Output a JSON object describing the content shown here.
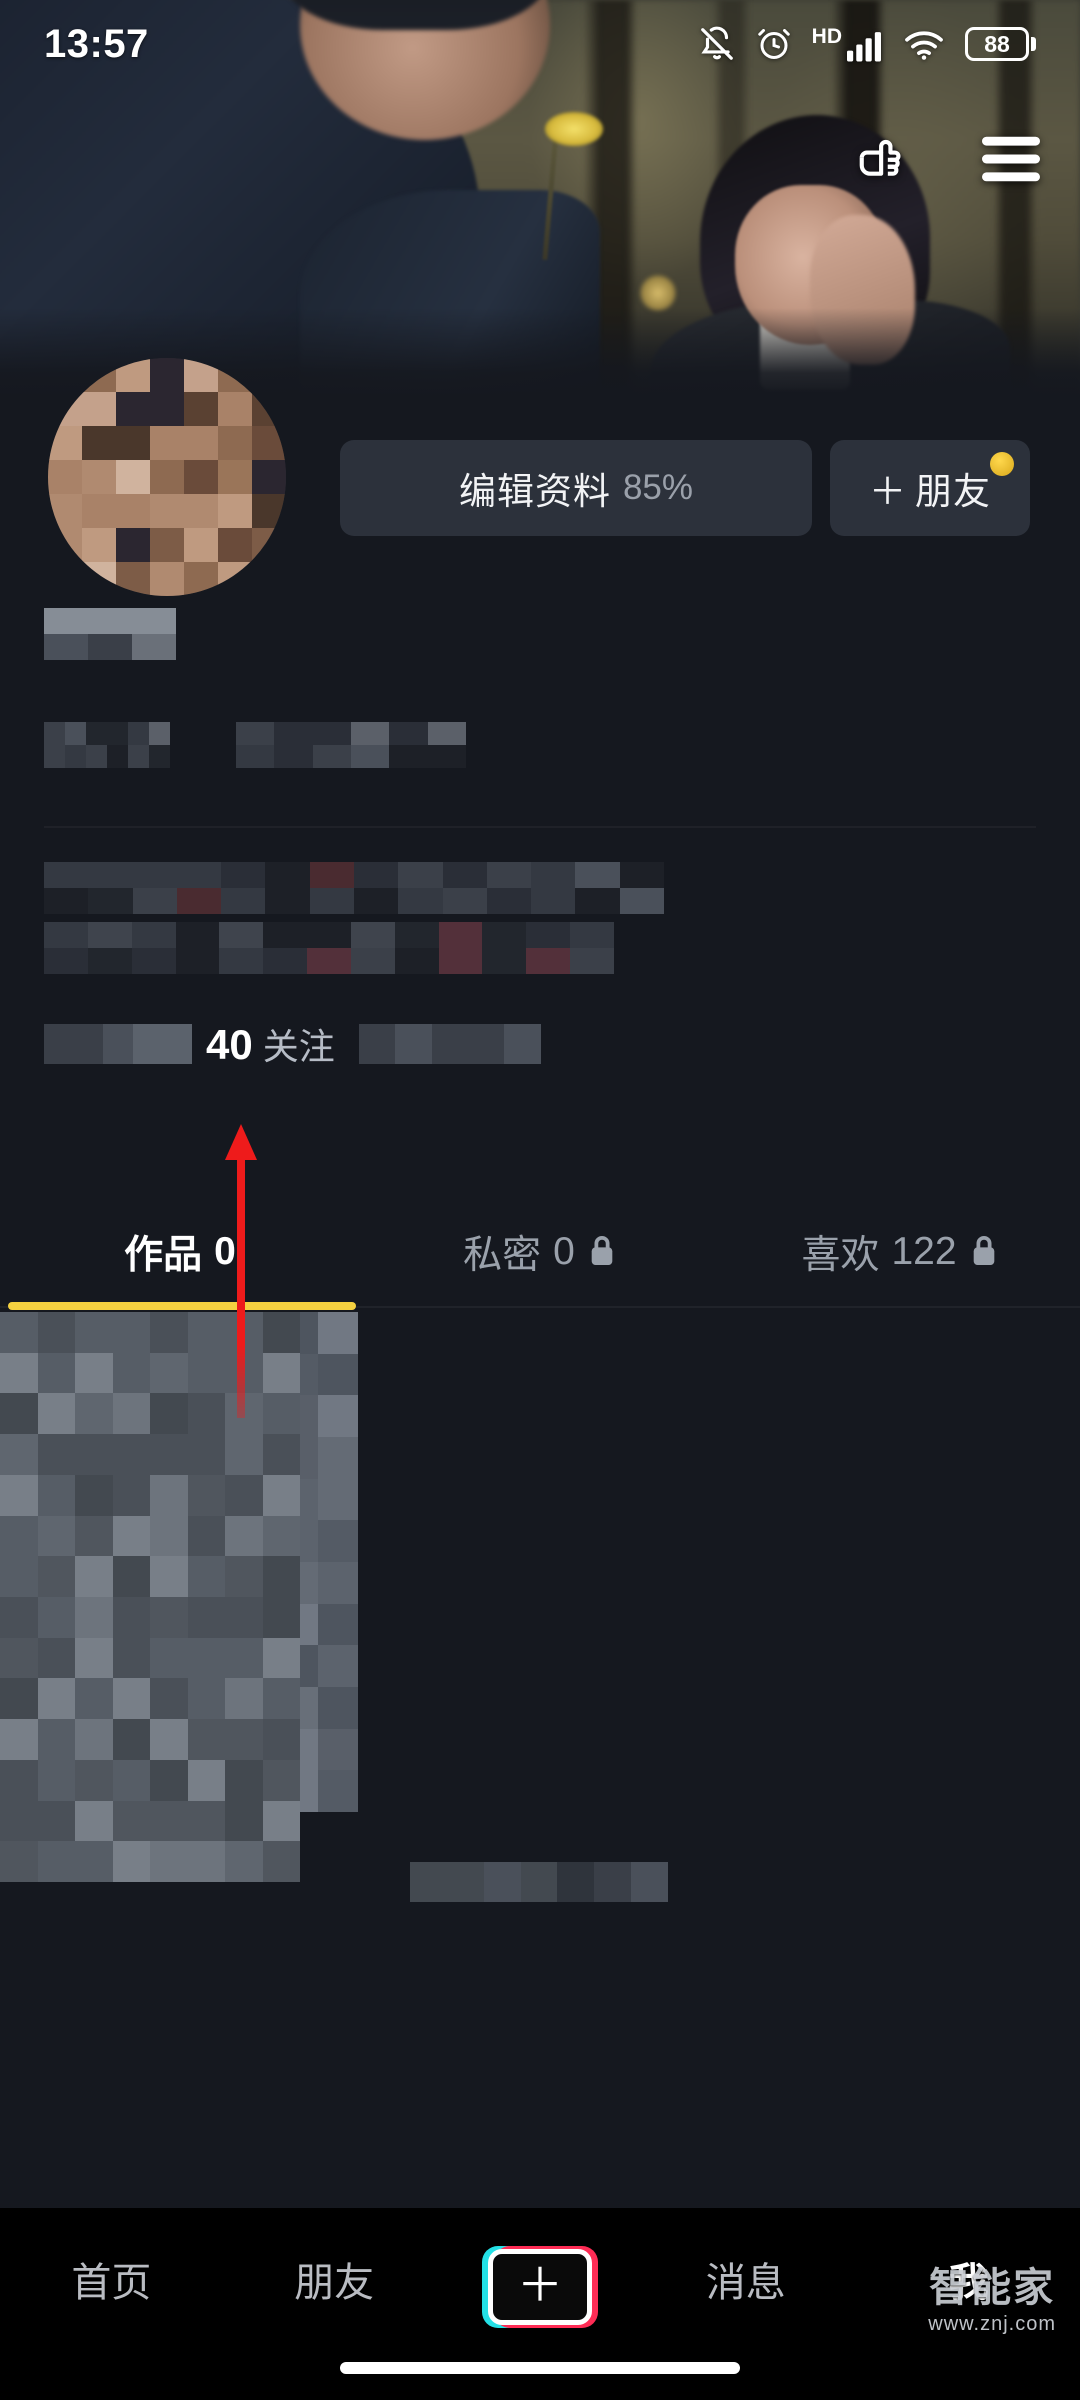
{
  "status_bar": {
    "time": "13:57",
    "battery_level": "88",
    "icons": [
      "bell-mute-icon",
      "alarm-clock-icon",
      "hd-icon",
      "signal-bars-icon",
      "wifi-icon",
      "battery-icon"
    ],
    "hd_label": "HD"
  },
  "cover": {
    "actions": [
      "pointing-hand-icon",
      "hamburger-menu-icon"
    ]
  },
  "profile": {
    "edit_button": {
      "label": "编辑资料",
      "percent": "85%"
    },
    "friend_button": {
      "label": "朋友",
      "plus": "＋",
      "has_badge": true
    },
    "stats": {
      "follow_count": "40",
      "follow_label": "关注"
    }
  },
  "tabs": [
    {
      "label": "作品",
      "count": "0",
      "locked": false,
      "active": true
    },
    {
      "label": "私密",
      "count": "0",
      "locked": true,
      "active": false
    },
    {
      "label": "喜欢",
      "count": "122",
      "locked": true,
      "active": false
    }
  ],
  "bottom_nav": [
    {
      "label": "首页",
      "active": false
    },
    {
      "label": "朋友",
      "active": false
    },
    {
      "label": "＋",
      "active": false,
      "is_create": true
    },
    {
      "label": "消息",
      "active": false
    },
    {
      "label": "我",
      "active": true
    }
  ],
  "watermark": {
    "main": "智能家",
    "sub": "www.znj.com"
  },
  "colors": {
    "accent_yellow": "#f5d140",
    "annotation_red": "#ee1b1b",
    "background": "#15181f",
    "nav_background": "#000000",
    "button_background": "#2c313b",
    "create_cyan": "#24e0e6",
    "create_pink": "#fe2c55"
  }
}
